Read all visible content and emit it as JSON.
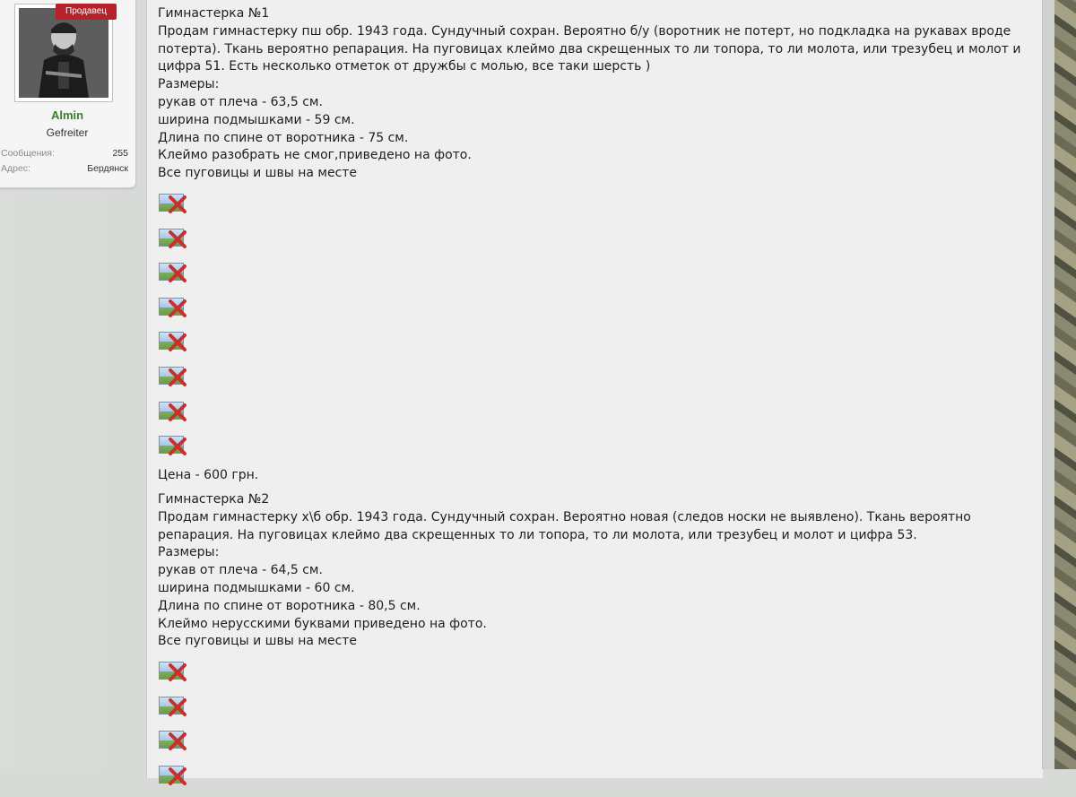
{
  "user": {
    "badge": "Продавец",
    "name": "Almin",
    "rank": "Gefreiter",
    "stats": [
      {
        "label": "Сообщения:",
        "value": "255"
      },
      {
        "label": "Адрес:",
        "value": "Бердянск"
      }
    ]
  },
  "post": {
    "item1": {
      "title": "Гимнастерка №1",
      "desc1": "Продам гимнастерку пш обр. 1943 года. Сундучный сохран. Вероятно б/у (воротник не потерт, но подкладка на рукавах вроде",
      "desc2": "потерта). Ткань вероятно репарация. На пуговицах клеймо два скрещенных то ли топора, то ли молота, или трезубец и молот и",
      "desc3": "цифра 51. Есть несколько отметок от дружбы с молью, все таки шерсть )",
      "sizes_label": "Размеры:",
      "sleeve": "рукав от плеча - 63,5 см.",
      "chest": "ширина подмышками - 59 см.",
      "length": "Длина по спине от воротника - 75 см.",
      "stamp": "Клеймо разобрать не смог,приведено на фото.",
      "buttons": "Все пуговицы и швы на месте",
      "price": "Цена - 600 грн."
    },
    "item2": {
      "title": "Гимнастерка №2",
      "desc1": "Продам гимнастерку х\\б обр. 1943 года. Сундучный сохран. Вероятно новая (следов носки не выявлено). Ткань вероятно",
      "desc2": "репарация. На пуговицах клеймо два скрещенных то ли топора, то ли молота, или трезубец и молот и цифра 53.",
      "sizes_label": "Размеры:",
      "sleeve": "рукав от плеча - 64,5 см.",
      "chest": "ширина подмышками - 60 см.",
      "length": "Длина по спине от воротника - 80,5 см.",
      "stamp": "Клеймо нерусскими буквами приведено на фото.",
      "buttons": "Все пуговицы и швы на месте"
    }
  },
  "colors": {
    "badge_bg": "#b7222a",
    "username": "#3d7c2c",
    "post_bg": "#efefef"
  },
  "icons": {
    "broken_image": "broken-image-icon"
  }
}
